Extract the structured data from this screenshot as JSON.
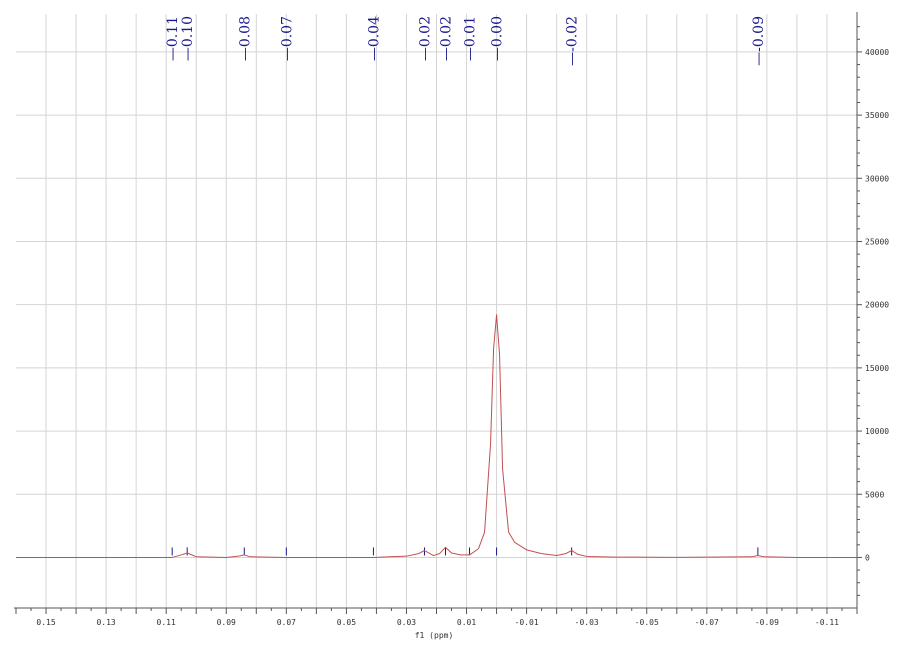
{
  "chart_data": {
    "type": "line",
    "xlabel": "f1 (ppm)",
    "ylabel": "",
    "x_reversed": true,
    "xlim": [
      0.16,
      -0.12
    ],
    "ylim": [
      -4000,
      43000
    ],
    "grid": true,
    "x_ticks": [
      0.15,
      0.13,
      0.11,
      0.09,
      0.07,
      0.05,
      0.03,
      0.01,
      -0.01,
      -0.03,
      -0.05,
      -0.07,
      -0.09,
      -0.11
    ],
    "x_tick_labels": [
      "0.15",
      "0.13",
      "0.11",
      "0.09",
      "0.07",
      "0.05",
      "0.03",
      "0.01",
      "-0.01",
      "-0.03",
      "-0.05",
      "-0.07",
      "-0.09",
      "-0.11"
    ],
    "y_ticks": [
      0,
      5000,
      10000,
      15000,
      20000,
      25000,
      30000,
      35000,
      40000
    ],
    "y_tick_labels": [
      "0",
      "5000",
      "10000",
      "15000",
      "20000",
      "25000",
      "30000",
      "35000",
      "40000"
    ],
    "peak_labels": [
      {
        "ppm": 0.108,
        "label": "0.11"
      },
      {
        "ppm": 0.103,
        "label": "0.10"
      },
      {
        "ppm": 0.084,
        "label": "0.08"
      },
      {
        "ppm": 0.07,
        "label": "0.07"
      },
      {
        "ppm": 0.041,
        "label": "0.04"
      },
      {
        "ppm": 0.024,
        "label": "0.02"
      },
      {
        "ppm": 0.017,
        "label": "0.02"
      },
      {
        "ppm": 0.009,
        "label": "0.01"
      },
      {
        "ppm": 0.0,
        "label": "0.00"
      },
      {
        "ppm": -0.025,
        "label": "-0.02"
      },
      {
        "ppm": -0.087,
        "label": "-0.09"
      }
    ],
    "series": [
      {
        "x": [
          0.16,
          0.12,
          0.108,
          0.105,
          0.103,
          0.1,
          0.09,
          0.086,
          0.084,
          0.082,
          0.07,
          0.05,
          0.041,
          0.03,
          0.026,
          0.024,
          0.021,
          0.019,
          0.017,
          0.015,
          0.012,
          0.009,
          0.006,
          0.004,
          0.002,
          0.001,
          0.0,
          -0.001,
          -0.002,
          -0.004,
          -0.006,
          -0.01,
          -0.015,
          -0.02,
          -0.023,
          -0.025,
          -0.027,
          -0.03,
          -0.04,
          -0.06,
          -0.085,
          -0.087,
          -0.089,
          -0.1,
          -0.12
        ],
        "y": [
          0,
          0,
          0,
          200,
          350,
          60,
          0,
          100,
          200,
          50,
          0,
          0,
          0,
          100,
          300,
          550,
          150,
          300,
          800,
          350,
          200,
          200,
          700,
          2000,
          9000,
          16500,
          19200,
          16000,
          7000,
          2000,
          1200,
          600,
          300,
          150,
          300,
          550,
          250,
          80,
          30,
          10,
          50,
          150,
          50,
          0,
          0
        ]
      }
    ],
    "colors": {
      "spectrum": "#c05050",
      "peak_label": "#1a1a8c",
      "grid": "#d4d4d4",
      "axis": "#555555"
    }
  }
}
